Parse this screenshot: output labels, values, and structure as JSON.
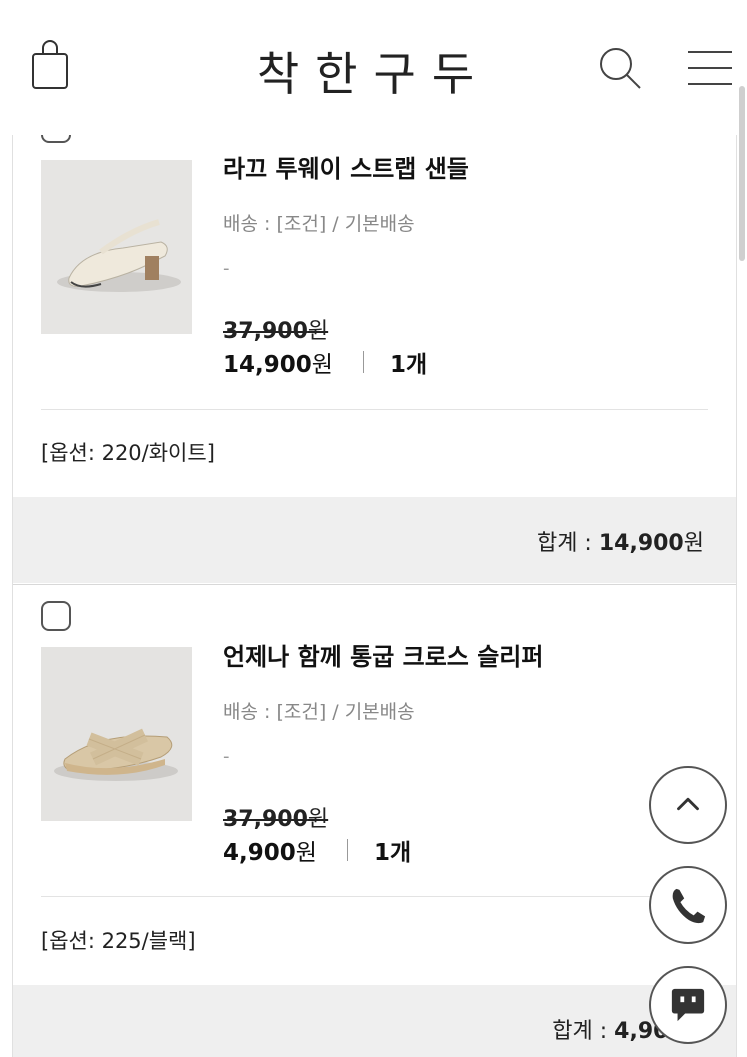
{
  "header": {
    "brand": "착한구두"
  },
  "products": [
    {
      "name": "라끄 투웨이 스트랩 샌들",
      "shipping": "배송 : [조건] / 기본배송",
      "dash": "-",
      "original_price": "37,900",
      "price": "14,900",
      "currency": "원",
      "quantity": "1개",
      "option": "[옵션: 220/화이트]",
      "total_label": "합계 : ",
      "total_amount": "14,900",
      "thumb_icon": "beige-strap-sandal-image"
    },
    {
      "name": "언제나 함께 통굽 크로스 슬리퍼",
      "shipping": "배송 : [조건] / 기본배송",
      "dash": "-",
      "original_price": "37,900",
      "price": "4,900",
      "currency": "원",
      "quantity": "1개",
      "option": "[옵션: 225/블랙]",
      "total_label": "합계 : ",
      "total_amount": "4,900",
      "thumb_icon": "cross-slipper-image"
    }
  ],
  "floating": {
    "icons": [
      "chevron-up-icon",
      "phone-icon",
      "chat-icon"
    ]
  }
}
